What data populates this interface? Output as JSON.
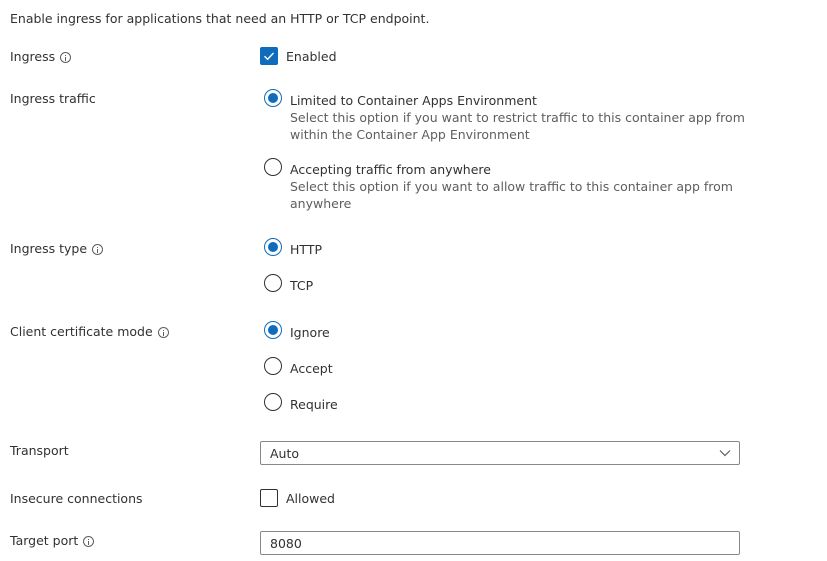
{
  "intro": "Enable ingress for applications that need an HTTP or TCP endpoint.",
  "ingress": {
    "label": "Ingress",
    "checkbox_label": "Enabled",
    "checked": true
  },
  "ingress_traffic": {
    "label": "Ingress traffic",
    "options": [
      {
        "label": "Limited to Container Apps Environment",
        "description_line1": "Select this option if you want to restrict traffic to this container app from",
        "description_line2": "within the Container App Environment",
        "selected": true
      },
      {
        "label": "Accepting traffic from anywhere",
        "description_line1": "Select this option if you want to allow traffic to this container app from",
        "description_line2": "anywhere",
        "selected": false
      }
    ]
  },
  "ingress_type": {
    "label": "Ingress type",
    "options": [
      {
        "label": "HTTP",
        "selected": true
      },
      {
        "label": "TCP",
        "selected": false
      }
    ]
  },
  "client_certificate_mode": {
    "label": "Client certificate mode",
    "options": [
      {
        "label": "Ignore",
        "selected": true
      },
      {
        "label": "Accept",
        "selected": false
      },
      {
        "label": "Require",
        "selected": false
      }
    ]
  },
  "transport": {
    "label": "Transport",
    "value": "Auto"
  },
  "insecure_connections": {
    "label": "Insecure connections",
    "checkbox_label": "Allowed",
    "checked": false
  },
  "target_port": {
    "label": "Target port",
    "value": "8080"
  },
  "colors": {
    "accent": "#0f6cbd",
    "text": "#323130",
    "border": "#8a8886"
  }
}
